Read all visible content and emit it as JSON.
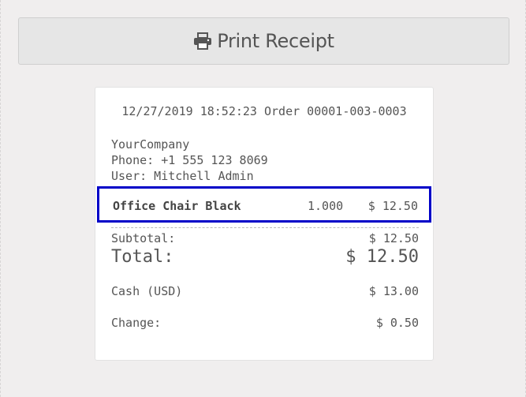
{
  "print_button": {
    "label": "Print Receipt",
    "icon": "printer-icon"
  },
  "receipt": {
    "header": "12/27/2019 18:52:23 Order 00001-003-0003",
    "company": "YourCompany",
    "phone": "Phone: +1 555 123 8069",
    "user": "User: Mitchell Admin",
    "line_items": [
      {
        "name": "Office Chair Black",
        "quantity": "1.000",
        "price": "$ 12.50"
      }
    ],
    "subtotal_label": "Subtotal:",
    "subtotal_value": "$ 12.50",
    "total_label": "Total:",
    "total_value": "$ 12.50",
    "cash_label": "Cash (USD)",
    "cash_value": "$ 13.00",
    "change_label": "Change:",
    "change_value": "$ 0.50"
  },
  "colors": {
    "background": "#f0eeee",
    "button_background": "#e6e6e6",
    "receipt_background": "#ffffff",
    "text": "#555555",
    "highlight_border": "#0000c8"
  }
}
